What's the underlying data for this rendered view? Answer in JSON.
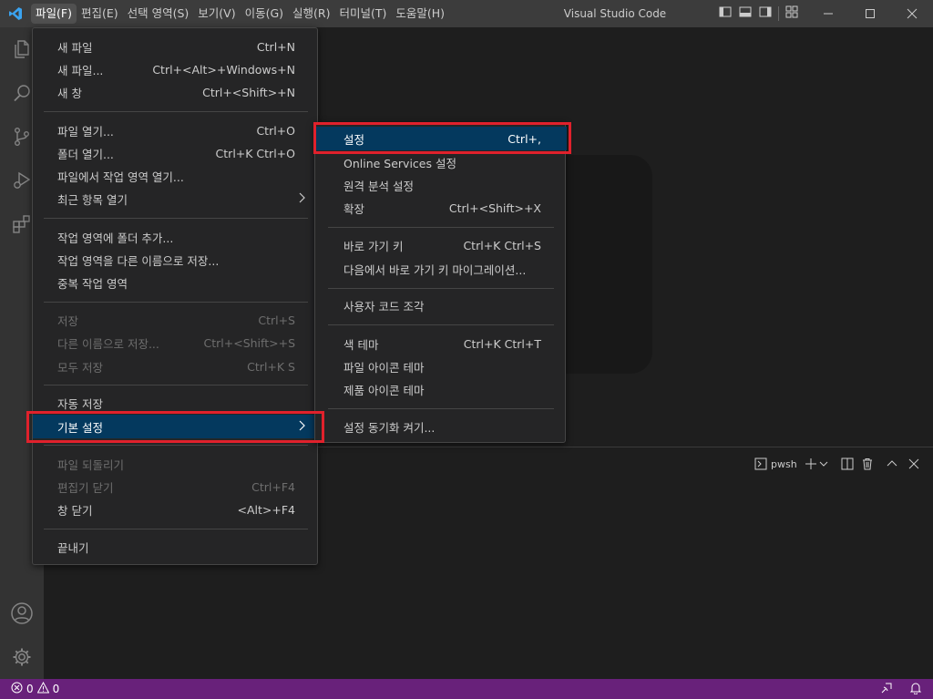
{
  "titlebar": {
    "menus": [
      "파일(F)",
      "편집(E)",
      "선택 영역(S)",
      "보기(V)",
      "이동(G)",
      "실행(R)",
      "터미널(T)",
      "도움말(H)"
    ],
    "title": "Visual Studio Code",
    "logo_icon": "vscode-logo-icon",
    "window_controls": [
      "minimize-icon",
      "maximize-icon",
      "close-icon"
    ]
  },
  "activitybar": {
    "icons": [
      "explorer-icon",
      "search-icon",
      "source-control-icon",
      "run-debug-icon",
      "extensions-icon",
      "accounts-icon",
      "manage-gear-icon"
    ]
  },
  "file_menu": {
    "items": [
      {
        "label": "새 파일",
        "shortcut": "Ctrl+N",
        "disabled": false
      },
      {
        "label": "새 파일...",
        "shortcut": "Ctrl+<Alt>+Windows+N",
        "disabled": false
      },
      {
        "label": "새 창",
        "shortcut": "Ctrl+<Shift>+N",
        "disabled": false
      },
      {
        "label": "파일 열기...",
        "shortcut": "Ctrl+O",
        "disabled": false
      },
      {
        "label": "폴더 열기...",
        "shortcut": "Ctrl+K Ctrl+O",
        "disabled": false
      },
      {
        "label": "파일에서 작업 영역 열기...",
        "shortcut": "",
        "disabled": false
      },
      {
        "label": "최근 항목 열기",
        "shortcut": "",
        "disabled": false,
        "submenu": true
      },
      {
        "label": "작업 영역에 폴더 추가...",
        "shortcut": "",
        "disabled": false
      },
      {
        "label": "작업 영역을 다른 이름으로 저장...",
        "shortcut": "",
        "disabled": false
      },
      {
        "label": "중복 작업 영역",
        "shortcut": "",
        "disabled": false
      },
      {
        "label": "저장",
        "shortcut": "Ctrl+S",
        "disabled": true
      },
      {
        "label": "다른 이름으로 저장...",
        "shortcut": "Ctrl+<Shift>+S",
        "disabled": true
      },
      {
        "label": "모두 저장",
        "shortcut": "Ctrl+K S",
        "disabled": true
      },
      {
        "label": "자동 저장",
        "shortcut": "",
        "disabled": false
      },
      {
        "label": "기본 설정",
        "shortcut": "",
        "disabled": false,
        "submenu": true,
        "selected": true
      },
      {
        "label": "파일 되돌리기",
        "shortcut": "",
        "disabled": true
      },
      {
        "label": "편집기 닫기",
        "shortcut": "Ctrl+F4",
        "disabled": true
      },
      {
        "label": "창 닫기",
        "shortcut": "<Alt>+F4",
        "disabled": false
      },
      {
        "label": "끝내기",
        "shortcut": "",
        "disabled": false
      }
    ]
  },
  "preferences_menu": {
    "items": [
      {
        "label": "설정",
        "shortcut": "Ctrl+,",
        "selected": true
      },
      {
        "label": "Online Services 설정",
        "shortcut": ""
      },
      {
        "label": "원격 분석 설정",
        "shortcut": ""
      },
      {
        "label": "확장",
        "shortcut": "Ctrl+<Shift>+X"
      },
      {
        "label": "바로 가기 키",
        "shortcut": "Ctrl+K Ctrl+S"
      },
      {
        "label": "다음에서 바로 가기 키 마이그레이션...",
        "shortcut": ""
      },
      {
        "label": "사용자 코드 조각",
        "shortcut": ""
      },
      {
        "label": "색 테마",
        "shortcut": "Ctrl+K Ctrl+T"
      },
      {
        "label": "파일 아이콘 테마",
        "shortcut": ""
      },
      {
        "label": "제품 아이콘 테마",
        "shortcut": ""
      },
      {
        "label": "설정 동기화 켜기...",
        "shortcut": ""
      }
    ]
  },
  "panel": {
    "terminal_name": "pwsh",
    "actions": [
      "terminal-icon",
      "add-icon",
      "chevron-down-icon",
      "split-icon",
      "trash-icon",
      "chevron-up-icon",
      "close-icon"
    ]
  },
  "statusbar": {
    "errors": "0",
    "warnings": "0",
    "right_icons": [
      "broadcast-icon",
      "bell-icon"
    ]
  },
  "colors": {
    "titlebar": "#3c3c3c",
    "activitybar": "#333333",
    "statusbar": "#68217a",
    "menu_bg": "#252526",
    "selection": "#04395e",
    "highlight_box": "#e0212c"
  }
}
